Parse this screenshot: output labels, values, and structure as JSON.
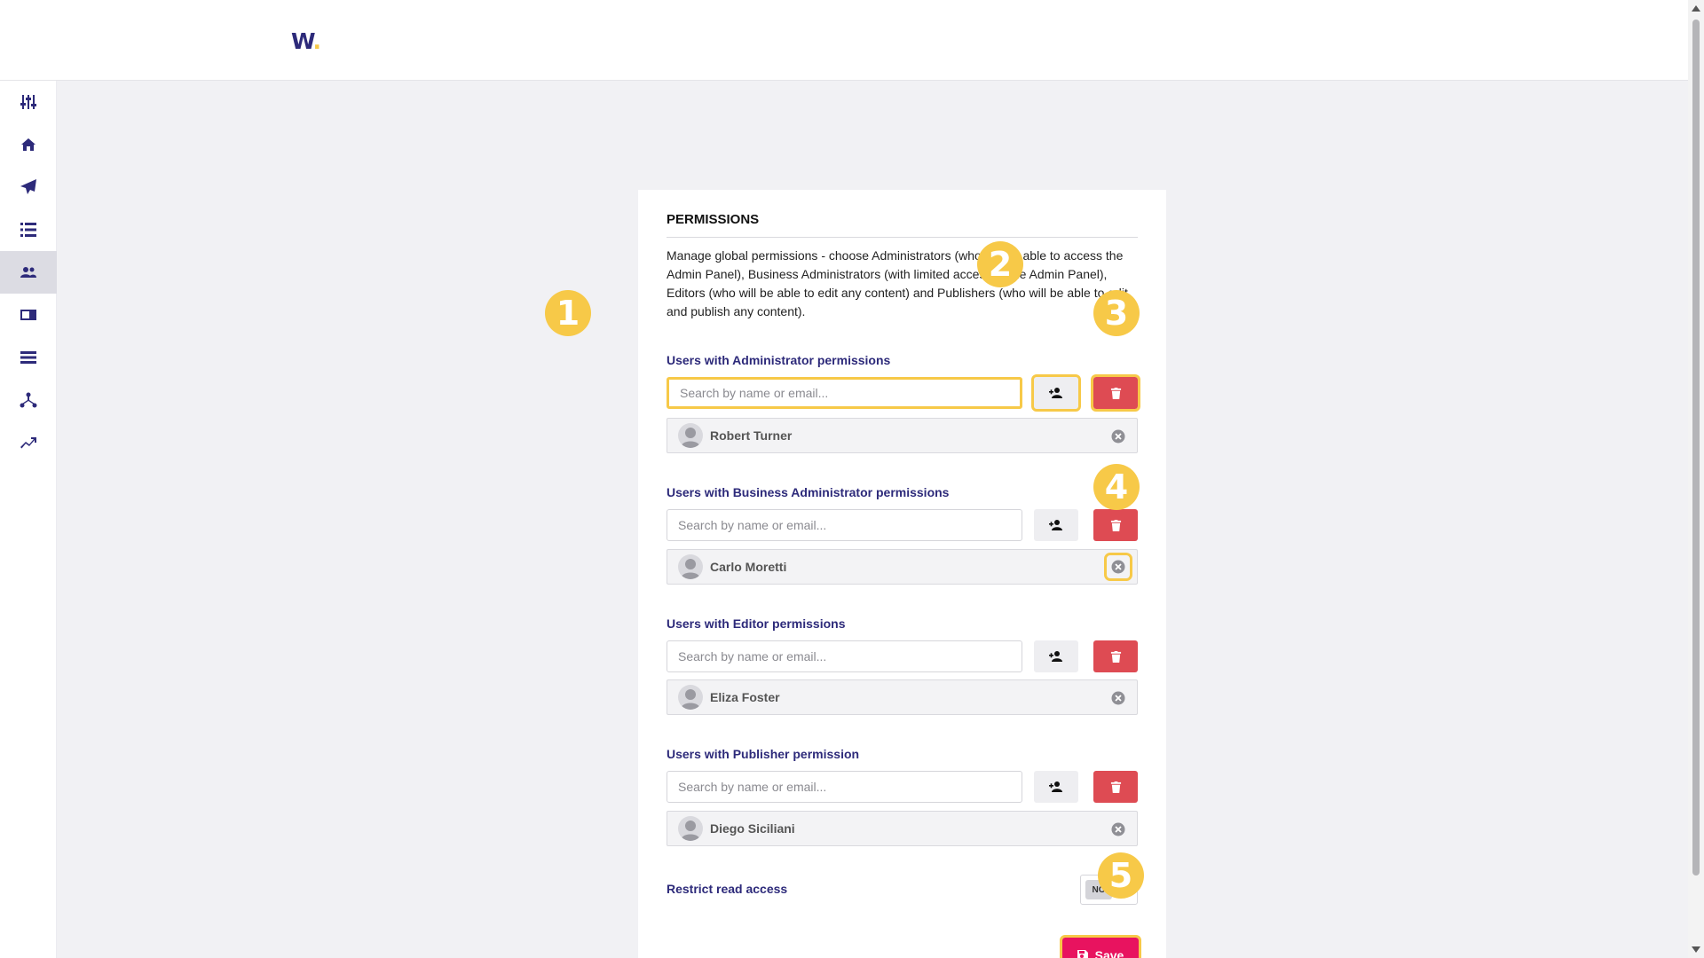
{
  "brand": {
    "logo_text": "W",
    "logo_dot": "."
  },
  "sidebar": {
    "items": [
      {
        "icon": "sliders-icon"
      },
      {
        "icon": "home-icon"
      },
      {
        "icon": "paper-plane-icon"
      },
      {
        "icon": "list-icon"
      },
      {
        "icon": "users-icon",
        "active": true
      },
      {
        "icon": "id-card-icon"
      },
      {
        "icon": "stacked-list-icon"
      },
      {
        "icon": "sitemap-icon"
      },
      {
        "icon": "trending-up-icon"
      }
    ]
  },
  "permissions": {
    "title": "PERMISSIONS",
    "description": "Manage global permissions - choose Administrators (who will be able to access the Admin Panel), Business Administrators (with limited access to the Admin Panel), Editors (who will be able to edit any content) and Publishers (who will be able to edit and publish any content).",
    "search_placeholder": "Search by name or email...",
    "sections": [
      {
        "label": "Users with Administrator permissions",
        "user": "Robert Turner"
      },
      {
        "label": "Users with Business Administrator permissions",
        "user": "Carlo Moretti"
      },
      {
        "label": "Users with Editor permissions",
        "user": "Eliza Foster"
      },
      {
        "label": "Users with Publisher permission",
        "user": "Diego Siciliani"
      }
    ],
    "restrict_label": "Restrict read access",
    "restrict_value": "NO",
    "save_label": "Save"
  },
  "callouts": [
    "1",
    "2",
    "3",
    "4",
    "5"
  ],
  "colors": {
    "accent": "#2d2a7a",
    "highlight": "#f7c948",
    "danger": "#de4b53",
    "save": "#e8135f"
  }
}
